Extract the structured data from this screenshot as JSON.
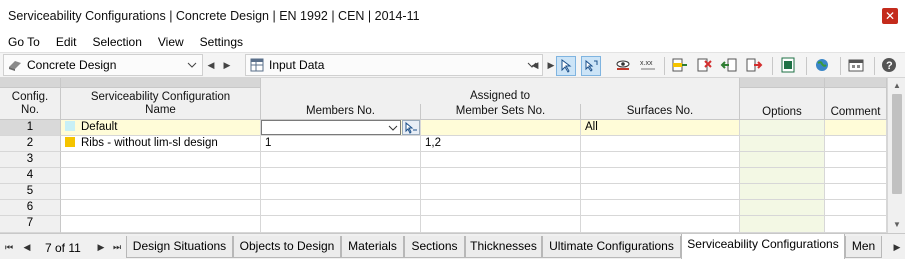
{
  "window": {
    "title": "Serviceability Configurations | Concrete Design | EN 1992 | CEN | 2014-11"
  },
  "menu": [
    "Go To",
    "Edit",
    "Selection",
    "View",
    "Settings"
  ],
  "toolbar": {
    "module": "Concrete Design",
    "input": "Input Data"
  },
  "table": {
    "headers": {
      "config_no": [
        "Config.",
        "No."
      ],
      "name": [
        "Serviceability Configuration",
        "Name"
      ],
      "assigned_to": "Assigned to",
      "members": "Members No.",
      "member_sets": "Member Sets No.",
      "surfaces": "Surfaces No.",
      "options": "Options",
      "comment": "Comment"
    },
    "rows": [
      {
        "no": "1",
        "name": "Default",
        "color": "#c8f0f6",
        "members": "",
        "member_sets": "",
        "surfaces": "All",
        "options": "",
        "comment": ""
      },
      {
        "no": "2",
        "name": "Ribs - without lim-sl design",
        "color": "#f5c400",
        "members": "1",
        "member_sets": "1,2",
        "surfaces": "",
        "options": "",
        "comment": ""
      },
      {
        "no": "3",
        "name": "",
        "color": "",
        "members": "",
        "member_sets": "",
        "surfaces": "",
        "options": "",
        "comment": ""
      },
      {
        "no": "4",
        "name": "",
        "color": "",
        "members": "",
        "member_sets": "",
        "surfaces": "",
        "options": "",
        "comment": ""
      },
      {
        "no": "5",
        "name": "",
        "color": "",
        "members": "",
        "member_sets": "",
        "surfaces": "",
        "options": "",
        "comment": ""
      },
      {
        "no": "6",
        "name": "",
        "color": "",
        "members": "",
        "member_sets": "",
        "surfaces": "",
        "options": "",
        "comment": ""
      },
      {
        "no": "7",
        "name": "",
        "color": "",
        "members": "",
        "member_sets": "",
        "surfaces": "",
        "options": "",
        "comment": ""
      }
    ]
  },
  "tabs": {
    "page_info": "7 of 11",
    "items": [
      "Design Situations",
      "Objects to Design",
      "Materials",
      "Sections",
      "Thicknesses",
      "Ultimate Configurations",
      "Serviceability Configurations",
      "Men"
    ],
    "active": "Serviceability Configurations"
  },
  "colors": {
    "selected_row": "#fffcd8",
    "options_column": "#f3f8e4",
    "header_bg": "#f0f0f0"
  }
}
